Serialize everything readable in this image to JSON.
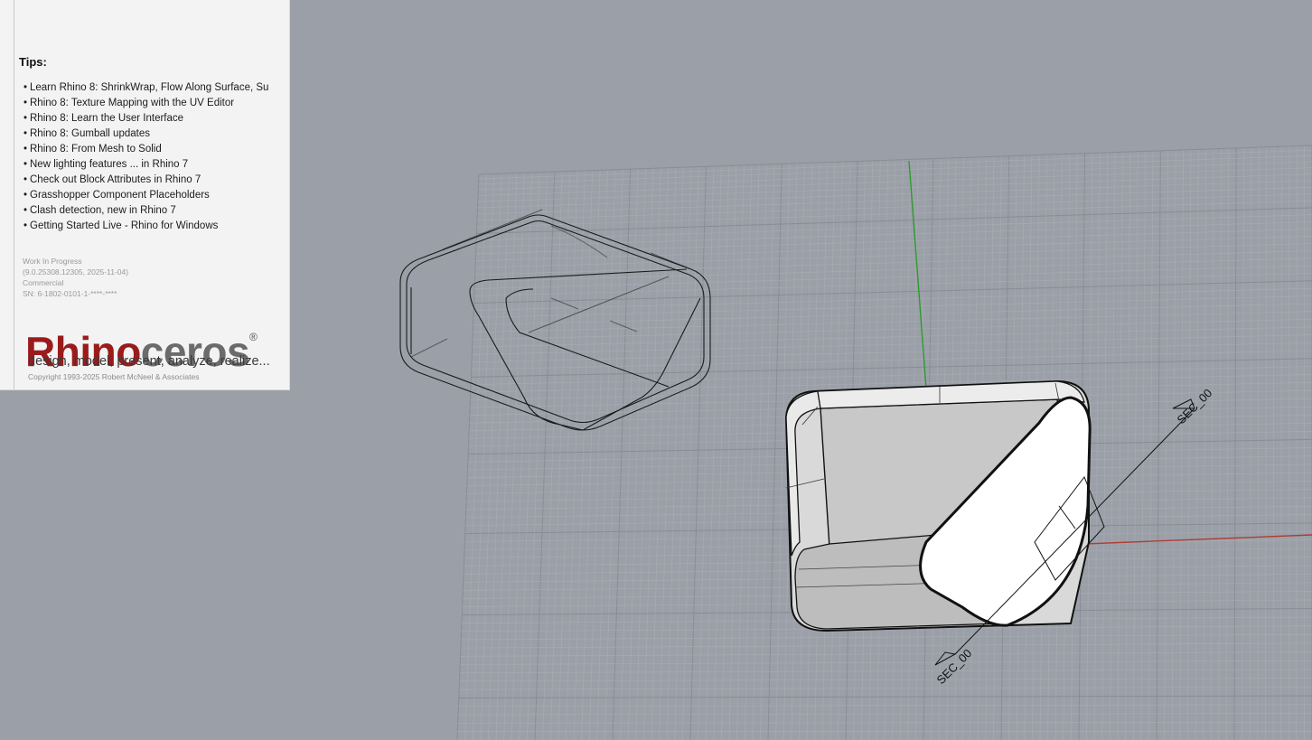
{
  "splash": {
    "tips_heading": "Tips:",
    "tips": [
      "Learn Rhino 8: ShrinkWrap, Flow Along Surface, Su",
      "Rhino 8: Texture Mapping with the UV Editor",
      "Rhino 8: Learn the User Interface",
      "Rhino 8: Gumball updates",
      "Rhino 8: From Mesh to Solid",
      "New lighting features ... in Rhino 7",
      "Check out Block Attributes in Rhino 7",
      "Grasshopper Component Placeholders",
      "Clash detection, new in Rhino 7",
      "Getting Started Live - Rhino for Windows"
    ],
    "version": {
      "line1": "Work In Progress",
      "line2": "(9.0.25308.12305, 2025-11-04)",
      "line3": "Commercial",
      "line4": "SN: 6-1802-0101-1-****-****"
    },
    "brand": {
      "part1": "Rhino",
      "part2": "ceros",
      "reg": "®"
    },
    "slogan": "design, model, present, analyze, realize...",
    "copyright": "Copyright 1993-2025  Robert McNeel  & Associates",
    "colors": {
      "brand_red": "#9a1b1c",
      "brand_gray": "#6b6b6b"
    }
  },
  "viewport": {
    "section_label_top": "SEC_00",
    "section_label_bottom": "SEC_00",
    "colors": {
      "background": "#9ba0a8",
      "grid_minor": "#a8acb3",
      "grid_major": "#888d95",
      "x_axis": "#b23a32",
      "y_axis": "#2e9a2e"
    }
  }
}
